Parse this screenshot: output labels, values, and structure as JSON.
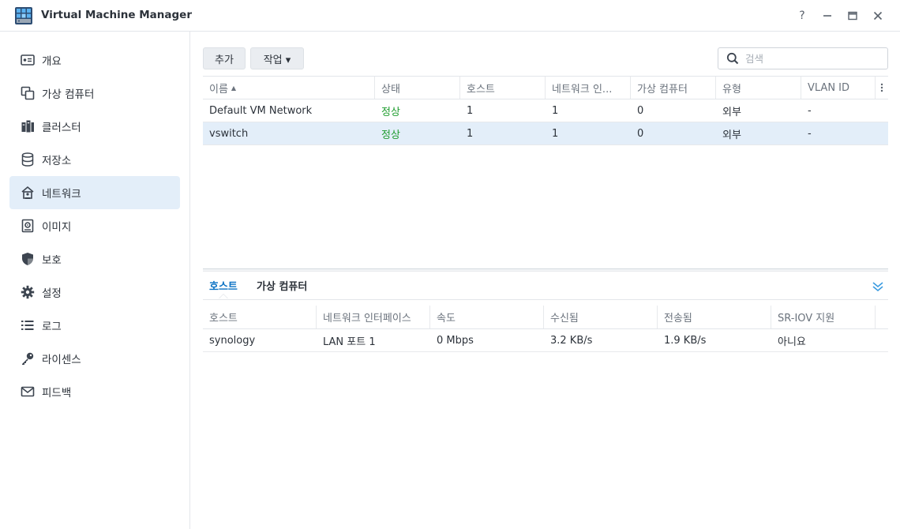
{
  "window": {
    "title": "Virtual Machine Manager",
    "help_label": "?",
    "minimize_label": "—",
    "close_label": "✕"
  },
  "sidebar": {
    "items": [
      {
        "label": "개요",
        "icon": "overview-icon"
      },
      {
        "label": "가상 컴퓨터",
        "icon": "virtual-machine-icon"
      },
      {
        "label": "클러스터",
        "icon": "cluster-icon"
      },
      {
        "label": "저장소",
        "icon": "storage-icon"
      },
      {
        "label": "네트워크",
        "icon": "network-icon",
        "active": true
      },
      {
        "label": "이미지",
        "icon": "image-icon"
      },
      {
        "label": "보호",
        "icon": "shield-icon"
      },
      {
        "label": "설정",
        "icon": "gear-icon"
      },
      {
        "label": "로그",
        "icon": "log-list-icon"
      },
      {
        "label": "라이센스",
        "icon": "key-icon"
      },
      {
        "label": "피드백",
        "icon": "mail-icon"
      }
    ]
  },
  "toolbar": {
    "add_label": "추가",
    "action_label": "작업 ▾",
    "search_placeholder": "검색"
  },
  "network_table": {
    "columns": [
      "이름",
      "상태",
      "호스트",
      "네트워크 인...",
      "가상 컴퓨터",
      "유형",
      "VLAN ID"
    ],
    "rows": [
      [
        "Default VM Network",
        "정상",
        "1",
        "1",
        "0",
        "외부",
        "-"
      ],
      [
        "vswitch",
        "정상",
        "1",
        "1",
        "0",
        "외부",
        "-"
      ]
    ],
    "selected_row": 1
  },
  "detail_tabs": {
    "items": [
      "호스트",
      "가상 컴퓨터"
    ],
    "active": 0
  },
  "host_table": {
    "columns": [
      "호스트",
      "네트워크 인터페이스",
      "속도",
      "수신됨",
      "전송됨",
      "SR-IOV 지원"
    ],
    "rows": [
      [
        "synology",
        "LAN 포트 1",
        "0 Mbps",
        "3.2 KB/s",
        "1.9 KB/s",
        "아니요"
      ]
    ]
  },
  "colors": {
    "accent": "#0b72c4",
    "status_ok": "#1f9d2f",
    "selected_bg": "#e3eef9"
  }
}
